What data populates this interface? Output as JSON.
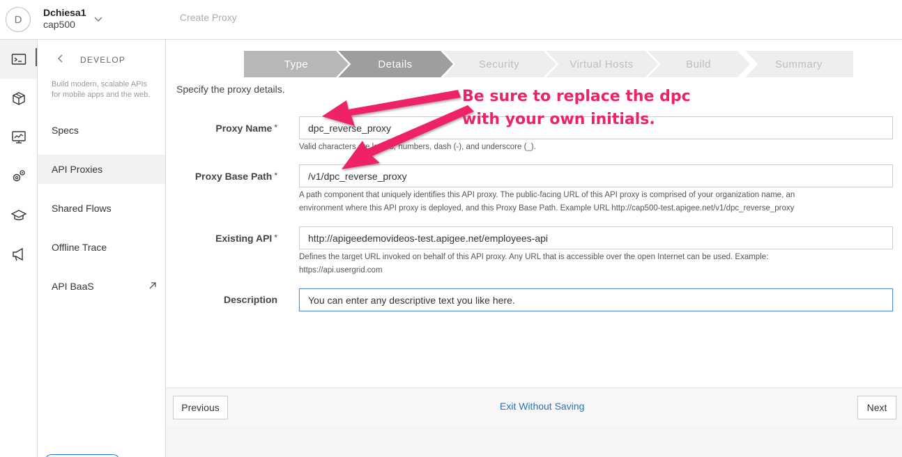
{
  "header": {
    "avatar_initial": "D",
    "user_name": "Dchiesa1",
    "org_name": "cap500",
    "page_title": "Create Proxy"
  },
  "rail": {
    "icons": [
      "develop-icon",
      "publish-icon",
      "analytics-icon",
      "admin-icon",
      "learn-icon",
      "announcements-icon"
    ]
  },
  "subnav": {
    "title": "DEVELOP",
    "description": "Build modern, scalable APIs for mobile apps and the web.",
    "items": [
      {
        "label": "Specs"
      },
      {
        "label": "API Proxies"
      },
      {
        "label": "Shared Flows"
      },
      {
        "label": "Offline Trace"
      },
      {
        "label": "API BaaS"
      }
    ]
  },
  "wizard": {
    "steps": [
      {
        "label": "Type",
        "state": "done"
      },
      {
        "label": "Details",
        "state": "current"
      },
      {
        "label": "Security",
        "state": "todo"
      },
      {
        "label": "Virtual Hosts",
        "state": "todo"
      },
      {
        "label": "Build",
        "state": "todo"
      },
      {
        "label": "Summary",
        "state": "todo"
      }
    ],
    "colors": {
      "done": "#b7b7b7",
      "current": "#9e9e9e",
      "todo": "#eeeeee",
      "done_text": "#ffffff",
      "todo_text": "#bdbdbd"
    }
  },
  "form": {
    "intro": "Specify the proxy details.",
    "proxy_name": {
      "label": "Proxy Name",
      "required_mark": "*",
      "value": "dpc_reverse_proxy",
      "help": "Valid characters are letters, numbers, dash (-), and underscore (_)."
    },
    "base_path": {
      "label": "Proxy Base Path",
      "required_mark": "*",
      "value": "/v1/dpc_reverse_proxy",
      "help_line1": "A path component that uniquely identifies this API proxy. The public-facing URL of this API proxy is comprised of your organization name, an",
      "help_line2": "environment where this API proxy is deployed, and this Proxy Base Path. Example URL http://cap500-test.apigee.net/v1/dpc_reverse_proxy"
    },
    "existing_api": {
      "label": "Existing API",
      "required_mark": "*",
      "value": "http://apigeedemovideos-test.apigee.net/employees-api",
      "help_line1": "Defines the target URL invoked on behalf of this API proxy. Any URL that is accessible over the open Internet can be used. Example:",
      "help_line2": "https://api.usergrid.com"
    },
    "description": {
      "label": "Description",
      "value": "You can enter any descriptive text you like here."
    }
  },
  "footer": {
    "previous_label": "Previous",
    "exit_label": "Exit Without Saving",
    "next_label": "Next"
  },
  "annotation": {
    "line1": "Be sure to replace the dpc",
    "line2": "with your own initials.",
    "color": "#ee2266"
  }
}
